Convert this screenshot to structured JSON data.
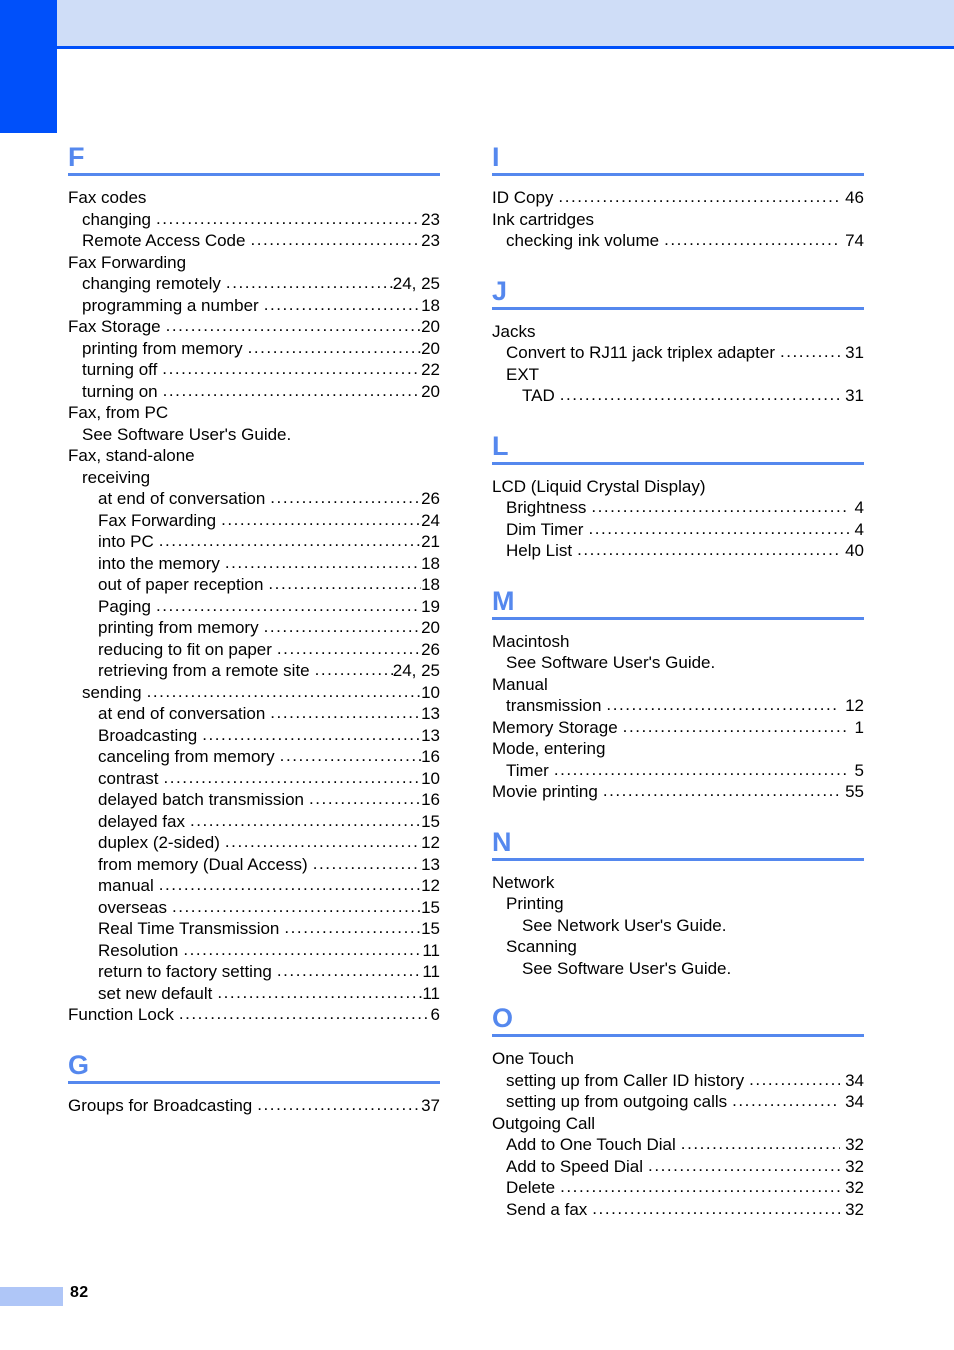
{
  "page": {
    "number": "82",
    "colors": {
      "accent_dark": "#0050FA",
      "accent_band": "#CFDDF7",
      "heading_blue": "#5588EE",
      "footer_block": "#AFC6F7"
    }
  },
  "columns": [
    {
      "id": "left",
      "sections": [
        {
          "letter": "F",
          "entries": [
            {
              "level": 0,
              "label": "Fax codes",
              "page": ""
            },
            {
              "level": 1,
              "label": "changing",
              "page": "23"
            },
            {
              "level": 1,
              "label": "Remote Access Code",
              "page": "23"
            },
            {
              "level": 0,
              "label": "Fax Forwarding",
              "page": ""
            },
            {
              "level": 1,
              "label": "changing remotely",
              "page": "24, 25"
            },
            {
              "level": 1,
              "label": "programming a number",
              "page": "18"
            },
            {
              "level": 0,
              "label": "Fax Storage",
              "page": "20"
            },
            {
              "level": 1,
              "label": "printing from memory",
              "page": "20"
            },
            {
              "level": 1,
              "label": "turning off",
              "page": "22"
            },
            {
              "level": 1,
              "label": "turning on",
              "page": "20"
            },
            {
              "level": 0,
              "label": "Fax, from PC",
              "page": ""
            },
            {
              "level": 1,
              "label": "See Software User's Guide.",
              "page": ""
            },
            {
              "level": 0,
              "label": "Fax, stand-alone",
              "page": ""
            },
            {
              "level": 1,
              "label": "receiving",
              "page": ""
            },
            {
              "level": 2,
              "label": "at end of conversation",
              "page": "26"
            },
            {
              "level": 2,
              "label": "Fax Forwarding",
              "page": "24"
            },
            {
              "level": 2,
              "label": "into PC",
              "page": "21"
            },
            {
              "level": 2,
              "label": "into the memory",
              "page": "18"
            },
            {
              "level": 2,
              "label": "out of paper reception",
              "page": "18"
            },
            {
              "level": 2,
              "label": "Paging",
              "page": "19"
            },
            {
              "level": 2,
              "label": "printing from memory",
              "page": "20"
            },
            {
              "level": 2,
              "label": "reducing to fit on paper",
              "page": "26"
            },
            {
              "level": 2,
              "label": "retrieving from a remote site",
              "page": "24, 25"
            },
            {
              "level": 1,
              "label": "sending",
              "page": "10"
            },
            {
              "level": 2,
              "label": "at end of conversation",
              "page": "13"
            },
            {
              "level": 2,
              "label": "Broadcasting",
              "page": "13"
            },
            {
              "level": 2,
              "label": "canceling from memory",
              "page": "16"
            },
            {
              "level": 2,
              "label": "contrast",
              "page": "10"
            },
            {
              "level": 2,
              "label": "delayed batch transmission",
              "page": "16"
            },
            {
              "level": 2,
              "label": "delayed fax",
              "page": "15"
            },
            {
              "level": 2,
              "label": "duplex (2-sided)",
              "page": "12"
            },
            {
              "level": 2,
              "label": "from memory (Dual Access)",
              "page": "13"
            },
            {
              "level": 2,
              "label": "manual",
              "page": "12"
            },
            {
              "level": 2,
              "label": "overseas",
              "page": "15"
            },
            {
              "level": 2,
              "label": "Real Time Transmission",
              "page": "15"
            },
            {
              "level": 2,
              "label": "Resolution",
              "page": "11"
            },
            {
              "level": 2,
              "label": "return to factory setting",
              "page": "11"
            },
            {
              "level": 2,
              "label": "set new default",
              "page": "11"
            },
            {
              "level": 0,
              "label": "Function Lock",
              "page": "6"
            }
          ]
        },
        {
          "letter": "G",
          "entries": [
            {
              "level": 0,
              "label": "Groups for Broadcasting",
              "page": "37"
            }
          ]
        }
      ]
    },
    {
      "id": "right",
      "sections": [
        {
          "letter": "I",
          "entries": [
            {
              "level": 0,
              "label": "ID Copy",
              "page": "46"
            },
            {
              "level": 0,
              "label": "Ink cartridges",
              "page": ""
            },
            {
              "level": 1,
              "label": "checking ink volume",
              "page": "74"
            }
          ]
        },
        {
          "letter": "J",
          "entries": [
            {
              "level": 0,
              "label": "Jacks",
              "page": ""
            },
            {
              "level": 1,
              "label": "Convert to RJ11 jack triplex adapter",
              "page": "31"
            },
            {
              "level": 1,
              "label": "EXT",
              "page": ""
            },
            {
              "level": 2,
              "label": "TAD",
              "page": "31"
            }
          ]
        },
        {
          "letter": "L",
          "entries": [
            {
              "level": 0,
              "label": "LCD (Liquid Crystal Display)",
              "page": ""
            },
            {
              "level": 1,
              "label": "Brightness",
              "page": "4"
            },
            {
              "level": 1,
              "label": "Dim Timer",
              "page": "4"
            },
            {
              "level": 1,
              "label": "Help List",
              "page": "40"
            }
          ]
        },
        {
          "letter": "M",
          "entries": [
            {
              "level": 0,
              "label": "Macintosh",
              "page": ""
            },
            {
              "level": 1,
              "label": "See Software User's Guide.",
              "page": ""
            },
            {
              "level": 0,
              "label": "Manual",
              "page": ""
            },
            {
              "level": 1,
              "label": "transmission",
              "page": "12"
            },
            {
              "level": 0,
              "label": "Memory Storage",
              "page": "1"
            },
            {
              "level": 0,
              "label": "Mode, entering",
              "page": ""
            },
            {
              "level": 1,
              "label": "Timer",
              "page": "5"
            },
            {
              "level": 0,
              "label": "Movie printing",
              "page": "55"
            }
          ]
        },
        {
          "letter": "N",
          "entries": [
            {
              "level": 0,
              "label": "Network",
              "page": ""
            },
            {
              "level": 1,
              "label": "Printing",
              "page": ""
            },
            {
              "level": 2,
              "label": "See Network User's Guide.",
              "page": ""
            },
            {
              "level": 1,
              "label": "Scanning",
              "page": ""
            },
            {
              "level": 2,
              "label": "See Software User's Guide.",
              "page": ""
            }
          ]
        },
        {
          "letter": "O",
          "entries": [
            {
              "level": 0,
              "label": "One Touch",
              "page": ""
            },
            {
              "level": 1,
              "label": "setting up from Caller ID history",
              "page": "34"
            },
            {
              "level": 1,
              "label": "setting up from outgoing calls",
              "page": "34"
            },
            {
              "level": 0,
              "label": "Outgoing Call",
              "page": ""
            },
            {
              "level": 1,
              "label": "Add to One Touch Dial",
              "page": "32"
            },
            {
              "level": 1,
              "label": "Add to Speed Dial",
              "page": "32"
            },
            {
              "level": 1,
              "label": "Delete",
              "page": "32"
            },
            {
              "level": 1,
              "label": "Send a fax",
              "page": "32"
            }
          ]
        }
      ]
    }
  ]
}
